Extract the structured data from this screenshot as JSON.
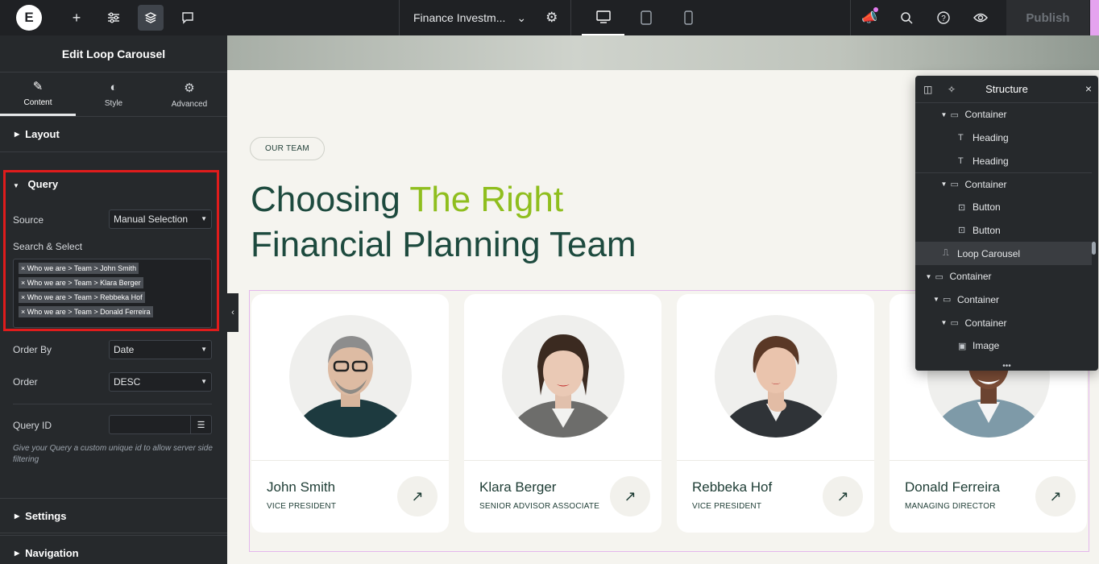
{
  "topbar": {
    "logo": "E",
    "icons": [
      "plus-icon",
      "sliders-icon",
      "layers-icon",
      "comment-icon"
    ],
    "doc_title": "Finance Investm...",
    "publish_label": "Publish",
    "devices": [
      "desktop",
      "tablet",
      "mobile"
    ],
    "right_icons": [
      "announcement-icon",
      "search-icon",
      "help-icon",
      "preview-icon"
    ]
  },
  "panel": {
    "title": "Edit Loop Carousel",
    "tabs": [
      {
        "label": "Content",
        "icon": "pencil-icon"
      },
      {
        "label": "Style",
        "icon": "contrast-icon"
      },
      {
        "label": "Advanced",
        "icon": "gear-icon"
      }
    ],
    "sections": {
      "layout": "Layout",
      "query": "Query",
      "settings": "Settings",
      "navigation": "Navigation"
    },
    "query": {
      "source_label": "Source",
      "source_value": "Manual Selection",
      "search_label": "Search & Select",
      "tags": [
        "× Who we are > Team > John Smith",
        "× Who we are > Team > Klara Berger",
        "× Who we are > Team > Rebbeka Hof",
        "× Who we are > Team > Donald Ferreira"
      ],
      "order_by_label": "Order By",
      "order_by_value": "Date",
      "order_label": "Order",
      "order_value": "DESC",
      "query_id_label": "Query ID",
      "query_id_value": "",
      "hint": "Give your Query a custom unique id to allow server side filtering"
    }
  },
  "canvas": {
    "pill": "OUR TEAM",
    "heading_part1": "Choosing ",
    "heading_accent": "The Right",
    "heading_line2": "Financial Planning Team",
    "accent_color": "#8fbe1e",
    "heading_color": "#1d4a3e",
    "cards": [
      {
        "name": "John Smith",
        "role": "VICE PRESIDENT"
      },
      {
        "name": "Klara Berger",
        "role": "SENIOR ADVISOR ASSOCIATE"
      },
      {
        "name": "Rebbeka Hof",
        "role": "VICE PRESIDENT"
      },
      {
        "name": "Donald Ferreira",
        "role": "MANAGING DIRECTOR"
      }
    ]
  },
  "structure": {
    "title": "Structure",
    "rows": [
      {
        "label": "Container",
        "indent": 3,
        "caret": true,
        "icon": "container-icon"
      },
      {
        "label": "Heading",
        "indent": 4,
        "caret": false,
        "icon": "heading-icon"
      },
      {
        "label": "Heading",
        "indent": 4,
        "caret": false,
        "icon": "heading-icon"
      },
      {
        "label": "Container",
        "indent": 3,
        "caret": true,
        "icon": "container-icon"
      },
      {
        "label": "Button",
        "indent": 4,
        "caret": false,
        "icon": "button-icon"
      },
      {
        "label": "Button",
        "indent": 4,
        "caret": false,
        "icon": "button-icon"
      },
      {
        "label": "Loop Carousel",
        "indent": 2,
        "caret": false,
        "icon": "carousel-icon",
        "selected": true
      },
      {
        "label": "Container",
        "indent": 1,
        "caret": true,
        "icon": "container-icon"
      },
      {
        "label": "Container",
        "indent": 2,
        "caret": true,
        "icon": "container-icon"
      },
      {
        "label": "Container",
        "indent": 3,
        "caret": true,
        "icon": "container-icon"
      },
      {
        "label": "Image",
        "indent": 4,
        "caret": false,
        "icon": "image-icon"
      }
    ]
  }
}
